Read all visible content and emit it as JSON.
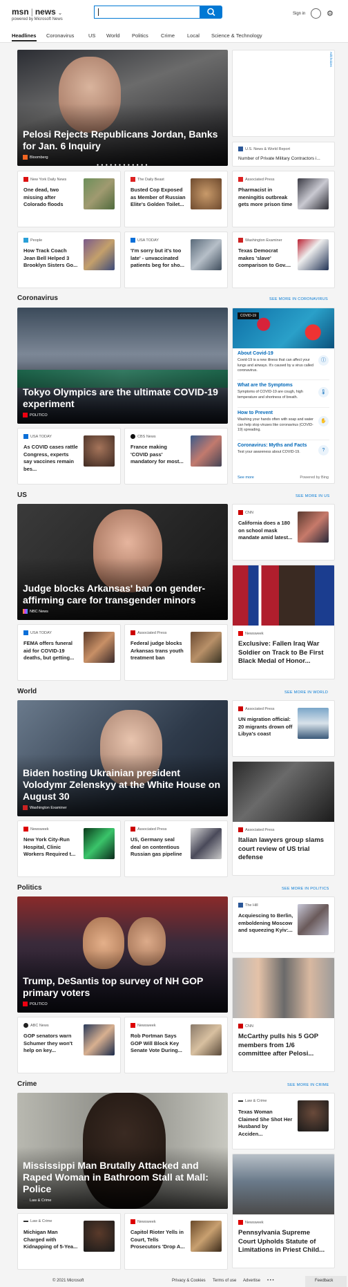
{
  "header": {
    "logo": "msn",
    "section": "news",
    "powered_by": "powered by Microsoft News",
    "search": {
      "value": "",
      "placeholder": ""
    },
    "sign_in": "Sign in"
  },
  "nav": [
    "Headlines",
    "Coronavirus",
    "US",
    "World",
    "Politics",
    "Crime",
    "Local",
    "Science & Technology"
  ],
  "top": {
    "hero": {
      "title": "Pelosi Rejects Republicans Jordan, Banks for Jan. 6 Inquiry",
      "source": "Bloomberg"
    },
    "ad_label": "AdChoices",
    "side": {
      "source": "U.S. News & World Report",
      "title": "Number of Private Military Contractors i..."
    },
    "cards": [
      {
        "source": "New York Daily News",
        "title": "One dead, two missing after Colorado floods"
      },
      {
        "source": "The Daily Beast",
        "title": "Busted Cop Exposed as Member of Russian Elite's Golden Toilet..."
      },
      {
        "source": "Associated Press",
        "title": "Pharmacist in meningitis outbreak gets more prison time"
      },
      {
        "source": "People",
        "title": "How Track Coach Jean Bell Helped 3 Brooklyn Sisters Go..."
      },
      {
        "source": "USA TODAY",
        "title": "'I'm sorry but it's too late' - unvaccinated patients beg for sho..."
      },
      {
        "source": "Washington Examiner",
        "title": "Texas Democrat makes 'slave' comparison to Gov...."
      }
    ]
  },
  "coronavirus": {
    "title": "Coronavirus",
    "see_more": "SEE MORE IN CORONAVIRUS",
    "hero": {
      "title": "Tokyo Olympics are the ultimate COVID-19 experiment",
      "source": "POLITICO"
    },
    "cards": [
      {
        "source": "USA TODAY",
        "title": "As COVID cases rattle Congress, experts say vaccines remain bes..."
      },
      {
        "source": "CBS News",
        "title": "France making 'COVID pass' mandatory for most..."
      }
    ],
    "widget": {
      "tag": "COVID-19",
      "items": [
        {
          "heading": "About Covid-19",
          "text": "Covid-19 is a new illness that can affect your lungs and airways. It's caused by a virus called coronavirus."
        },
        {
          "heading": "What are the Symptoms",
          "text": "Symptoms of COVID-19 are cough, high temperature and shortness of breath."
        },
        {
          "heading": "How to Prevent",
          "text": "Washing your hands often with soap and water can help stop viruses like coronavirus (COVID-19) spreading."
        },
        {
          "heading": "Coronavirus: Myths and Facts",
          "text": "Test your awareness about COVID-19."
        }
      ],
      "see_more": "See more",
      "powered": "Powered by Bing"
    }
  },
  "us": {
    "title": "US",
    "see_more": "SEE MORE IN US",
    "hero": {
      "title": "Judge blocks Arkansas' ban on gender-affirming care for transgender minors",
      "source": "NBC News"
    },
    "side1": {
      "source": "CNN",
      "title": "California does a 180 on school mask mandate amid latest..."
    },
    "side2": {
      "source": "Newsweek",
      "title": "Exclusive: Fallen Iraq War Soldier on Track to Be First Black Medal of Honor..."
    },
    "cards": [
      {
        "source": "USA TODAY",
        "title": "FEMA offers funeral aid for COVID-19 deaths, but getting..."
      },
      {
        "source": "Associated Press",
        "title": "Federal judge blocks Arkansas trans youth treatment ban"
      }
    ]
  },
  "world": {
    "title": "World",
    "see_more": "SEE MORE IN WORLD",
    "hero": {
      "title": "Biden hosting Ukrainian president Volodymr Zelenskyy at the White House on August 30",
      "source": "Washington Examiner"
    },
    "side1": {
      "source": "Associated Press",
      "title": "UN migration official: 20 migrants drown off Libya's coast"
    },
    "side2": {
      "source": "Associated Press",
      "title": "Italian lawyers group slams court review of US trial defense"
    },
    "cards": [
      {
        "source": "Newsweek",
        "title": "New York City-Run Hospital, Clinic Workers Required t..."
      },
      {
        "source": "Associated Press",
        "title": "US, Germany seal deal on contentious Russian gas pipeline"
      }
    ]
  },
  "politics": {
    "title": "Politics",
    "see_more": "SEE MORE IN POLITICS",
    "hero": {
      "title": "Trump, DeSantis top survey of NH GOP primary voters",
      "source": "POLITICO"
    },
    "side1": {
      "source": "The Hill",
      "title": "Acquiescing to Berlin, emboldening Moscow and squeezing Kyiv:..."
    },
    "side2": {
      "source": "CNN",
      "title": "McCarthy pulls his 5 GOP members from 1/6 committee after Pelosi..."
    },
    "cards": [
      {
        "source": "ABC News",
        "title": "GOP senators warn Schumer they won't help on key..."
      },
      {
        "source": "Newsweek",
        "title": "Rob Portman Says GOP Will Block Key Senate Vote During..."
      }
    ]
  },
  "crime": {
    "title": "Crime",
    "see_more": "SEE MORE IN CRIME",
    "hero": {
      "title": "Mississippi Man Brutally Attacked and Raped Woman in Bathroom Stall at Mall: Police",
      "source": "Law & Crime"
    },
    "side1": {
      "source": "Law & Crime",
      "title": "Texas Woman Claimed She Shot Her Husband by Acciden..."
    },
    "side2": {
      "source": "Newsweek",
      "title": "Pennsylvania Supreme Court Upholds Statute of Limitations in Priest Child..."
    },
    "cards": [
      {
        "source": "Law & Crime",
        "title": "Michigan Man Charged with Kidnapping of 5-Yea..."
      },
      {
        "source": "Newsweek",
        "title": "Capitol Rioter Yells in Court, Tells Prosecutors 'Drop A..."
      }
    ]
  },
  "footer": {
    "copyright": "© 2021 Microsoft",
    "privacy": "Privacy & Cookies",
    "terms": "Terms of use",
    "advertise": "Advertise",
    "more": "• • •",
    "feedback": "Feedback"
  }
}
